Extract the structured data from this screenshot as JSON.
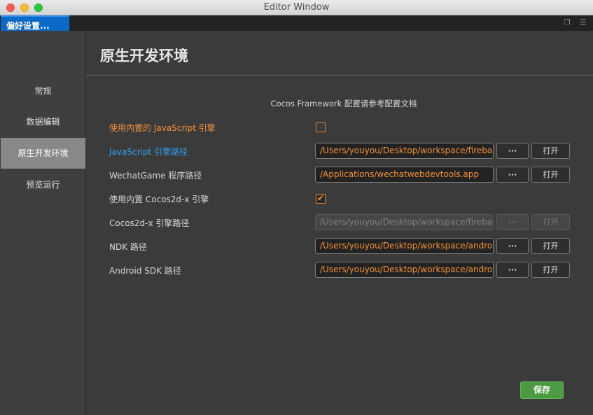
{
  "window": {
    "title": "Editor Window"
  },
  "tab": {
    "label": "偏好设置..."
  },
  "sidebar": {
    "items": [
      {
        "label": "常规",
        "active": false
      },
      {
        "label": "数据编辑",
        "active": false
      },
      {
        "label": "原生开发环境",
        "active": true
      },
      {
        "label": "预览运行",
        "active": false
      }
    ]
  },
  "main": {
    "title": "原生开发环境",
    "hint": "Cocos Framework 配置请参考配置文档",
    "rows": [
      {
        "label": "使用内置的 JavaScript 引擎",
        "type": "checkbox",
        "checked": false,
        "label_color": "#f5913a"
      },
      {
        "label": "JavaScript 引擎路径",
        "type": "path",
        "value": "/Users/youyou/Desktop/workspace/firebal",
        "label_color": "#33a3f5"
      },
      {
        "label": "WechatGame 程序路径",
        "type": "path",
        "value": "/Applications/wechatwebdevtools.app"
      },
      {
        "label": "使用内置 Cocos2d-x 引擎",
        "type": "checkbox",
        "checked": true
      },
      {
        "label": "Cocos2d-x 引擎路径",
        "type": "path",
        "value": "/Users/youyou/Desktop/workspace/firebal",
        "disabled": true
      },
      {
        "label": "NDK 路径",
        "type": "path",
        "value": "/Users/youyou/Desktop/workspace/androi"
      },
      {
        "label": "Android SDK 路径",
        "type": "path",
        "value": "/Users/youyou/Desktop/workspace/androi"
      }
    ],
    "browse_label": "···",
    "open_label": "打开",
    "save_label": "保存"
  },
  "colors": {
    "accent_orange": "#f5913a",
    "accent_blue": "#33a3f5",
    "save_green": "#4d9a44",
    "tab_blue": "#0c69c8"
  }
}
